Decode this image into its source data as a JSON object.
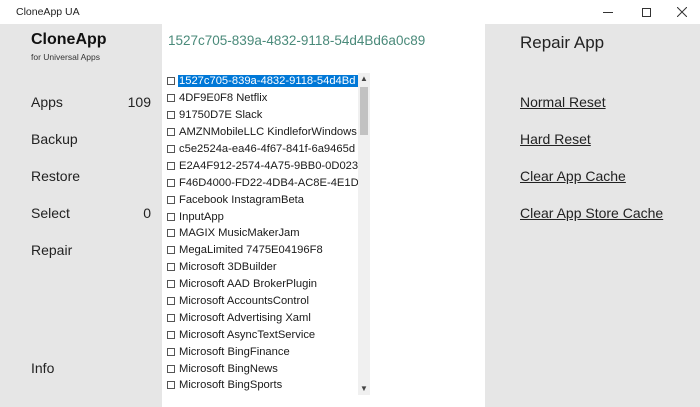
{
  "window": {
    "title": "CloneApp UA"
  },
  "sidebar": {
    "brand": "CloneApp",
    "brand_sub": "for Universal Apps",
    "items": [
      {
        "label": "Apps",
        "count": "109"
      },
      {
        "label": "Backup",
        "count": ""
      },
      {
        "label": "Restore",
        "count": ""
      },
      {
        "label": "Select",
        "count": "0"
      },
      {
        "label": "Repair",
        "count": ""
      },
      {
        "label": "Info",
        "count": ""
      }
    ]
  },
  "center": {
    "selected_id": "1527c705-839a-4832-9118-54d4Bd6a0c89",
    "apps": [
      "1527c705-839a-4832-9118-54d4Bd",
      "4DF9E0F8 Netflix",
      "91750D7E Slack",
      "AMZNMobileLLC KindleforWindows",
      "c5e2524a-ea46-4f67-841f-6a9465d",
      "E2A4F912-2574-4A75-9BB0-0D023",
      "F46D4000-FD22-4DB4-AC8E-4E1DD",
      "Facebook InstagramBeta",
      "InputApp",
      "MAGIX MusicMakerJam",
      "MegaLimited 7475E04196F8",
      "Microsoft 3DBuilder",
      "Microsoft AAD BrokerPlugin",
      "Microsoft AccountsControl",
      "Microsoft Advertising Xaml",
      "Microsoft AsyncTextService",
      "Microsoft BingFinance",
      "Microsoft BingNews",
      "Microsoft BingSports"
    ]
  },
  "right": {
    "title": "Repair App",
    "actions": [
      "Normal Reset",
      "Hard Reset",
      "Clear App Cache",
      "Clear App Store Cache"
    ]
  },
  "colors": {
    "sidebar_bg": "#e6e6e6",
    "selection": "#0078d7",
    "id_text": "#4a8a7a"
  },
  "icons": [
    "minimize-icon",
    "maximize-icon",
    "close-icon",
    "checkbox-icon",
    "scroll-up-icon",
    "scroll-down-icon"
  ]
}
